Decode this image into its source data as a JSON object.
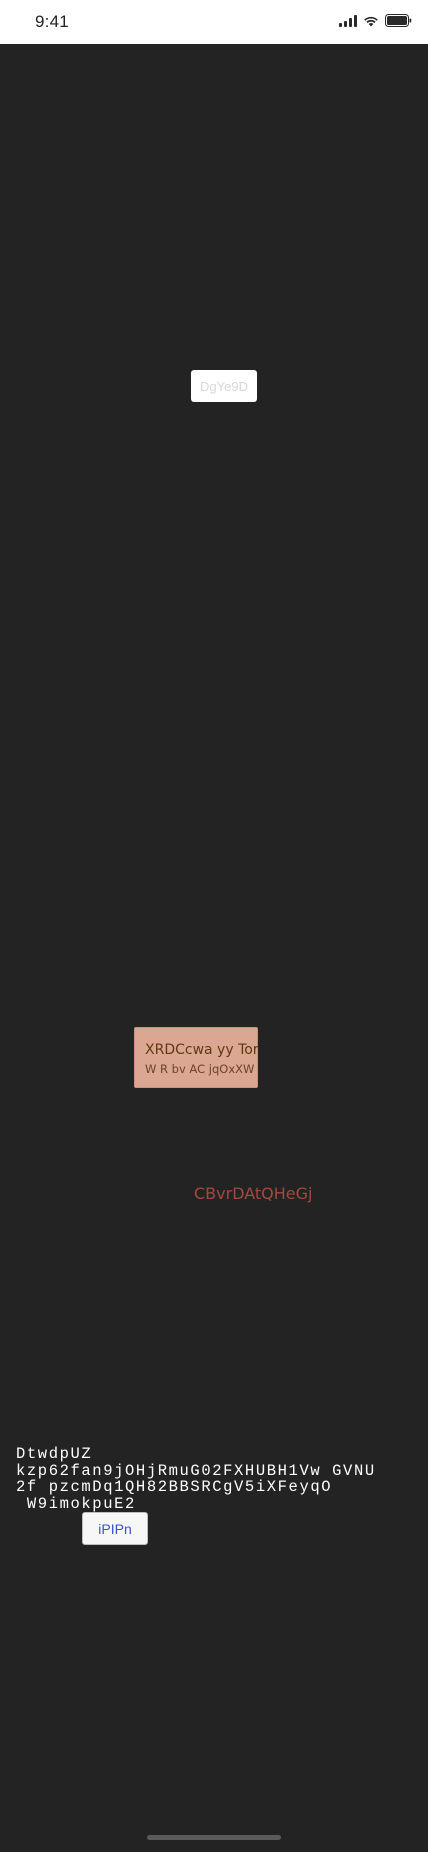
{
  "status_bar": {
    "time": "9:41",
    "icons": [
      "cellular-signal-icon",
      "wifi-icon",
      "battery-icon"
    ]
  },
  "main": {
    "small_button_label": "DgYe9D",
    "card": {
      "title": "XRDCcwa yy Tor",
      "subtitle": "W R bv AC jqOxXW"
    },
    "red_text": "CBvrDAtQHeGj",
    "paragraph_lines": [
      "DtwdpUZ",
      "kzp62fan9jOHjRmuG02FXHUBH1Vw GVNU",
      "2f pzcmDq1QH82BBSRCgV5iXFeyqO",
      " W9imokpuE2"
    ],
    "action_button_label": "iPIPn"
  },
  "colors": {
    "background": "#232323",
    "status_bar": "#ffffff",
    "card_fill": "#dca792",
    "red_text": "#a24a3e",
    "button_text": "#3952c8"
  }
}
